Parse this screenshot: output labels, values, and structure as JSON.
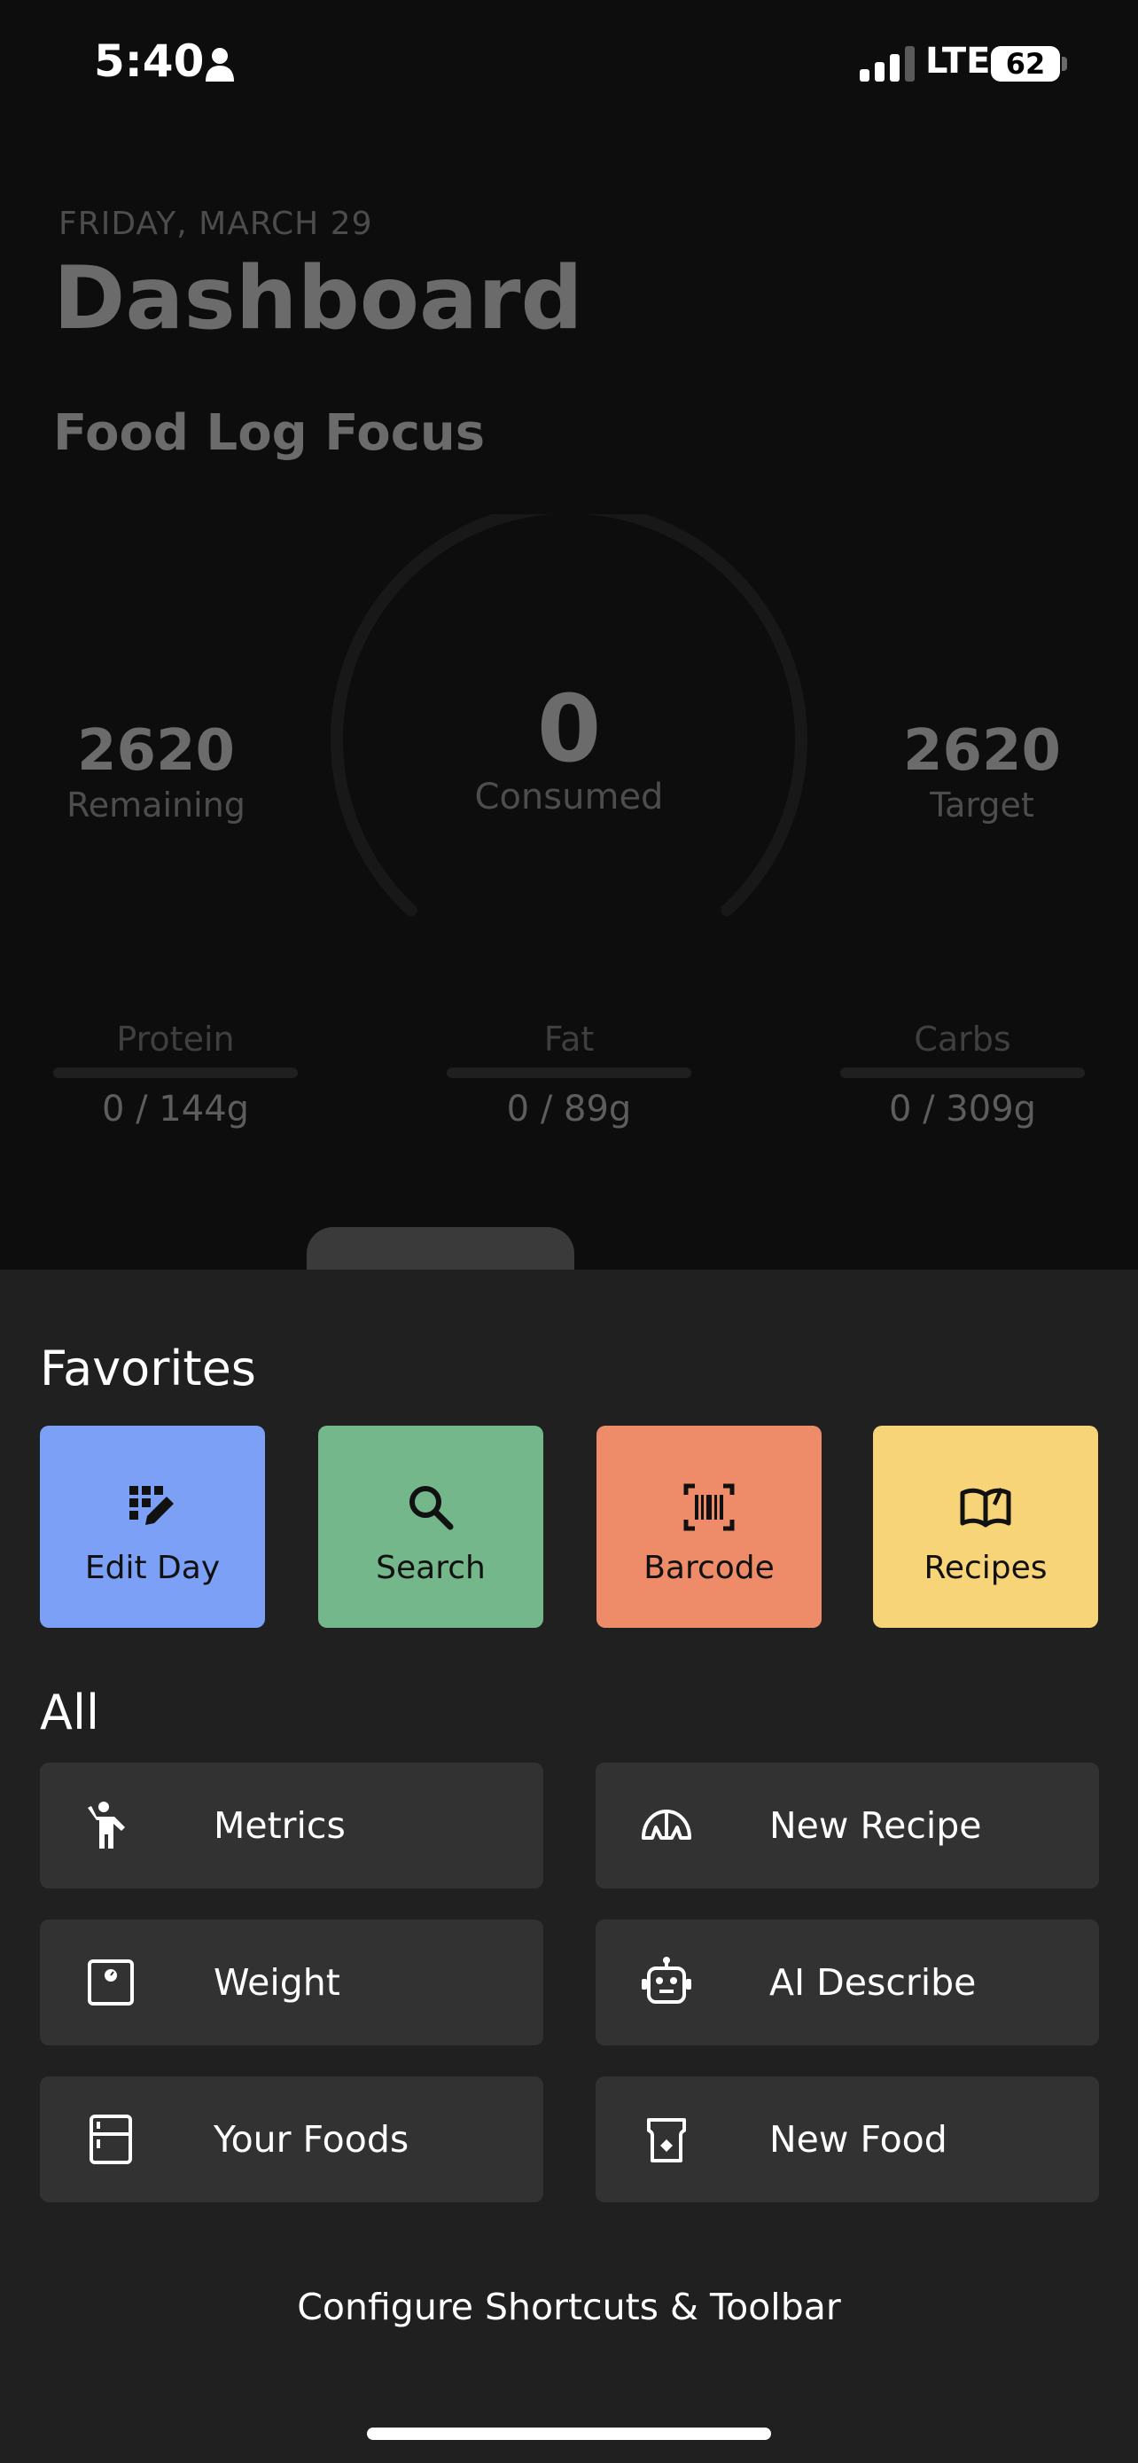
{
  "status_bar": {
    "time": "5:40",
    "network": "LTE",
    "battery": "62",
    "battery_level_percent": 62
  },
  "dashboard": {
    "date": "FRIDAY, MARCH 29",
    "title": "Dashboard",
    "section_title": "Food Log Focus",
    "remaining_value": "2620",
    "remaining_label": "Remaining",
    "consumed_value": "0",
    "consumed_label": "Consumed",
    "target_value": "2620",
    "target_label": "Target",
    "macros": [
      {
        "label": "Protein",
        "value": "0 / 144g"
      },
      {
        "label": "Fat",
        "value": "0 / 89g"
      },
      {
        "label": "Carbs",
        "value": "0 / 309g"
      }
    ]
  },
  "sheet": {
    "favorites_heading": "Favorites",
    "favorites": [
      {
        "label": "Edit Day",
        "icon": "edit-grid-icon",
        "color": "#7ba0f5"
      },
      {
        "label": "Search",
        "icon": "search-icon",
        "color": "#74b78b"
      },
      {
        "label": "Barcode",
        "icon": "barcode-icon",
        "color": "#ee8c6a"
      },
      {
        "label": "Recipes",
        "icon": "book-icon",
        "color": "#f7d477"
      }
    ],
    "all_heading": "All",
    "all_items": [
      {
        "label": "Metrics",
        "icon": "person-waving-icon"
      },
      {
        "label": "New Recipe",
        "icon": "croissant-icon"
      },
      {
        "label": "Weight",
        "icon": "scale-icon"
      },
      {
        "label": "AI Describe",
        "icon": "robot-icon"
      },
      {
        "label": "Your Foods",
        "icon": "fridge-icon"
      },
      {
        "label": "New Food",
        "icon": "food-box-icon"
      }
    ],
    "configure_label": "Configure Shortcuts & Toolbar"
  }
}
